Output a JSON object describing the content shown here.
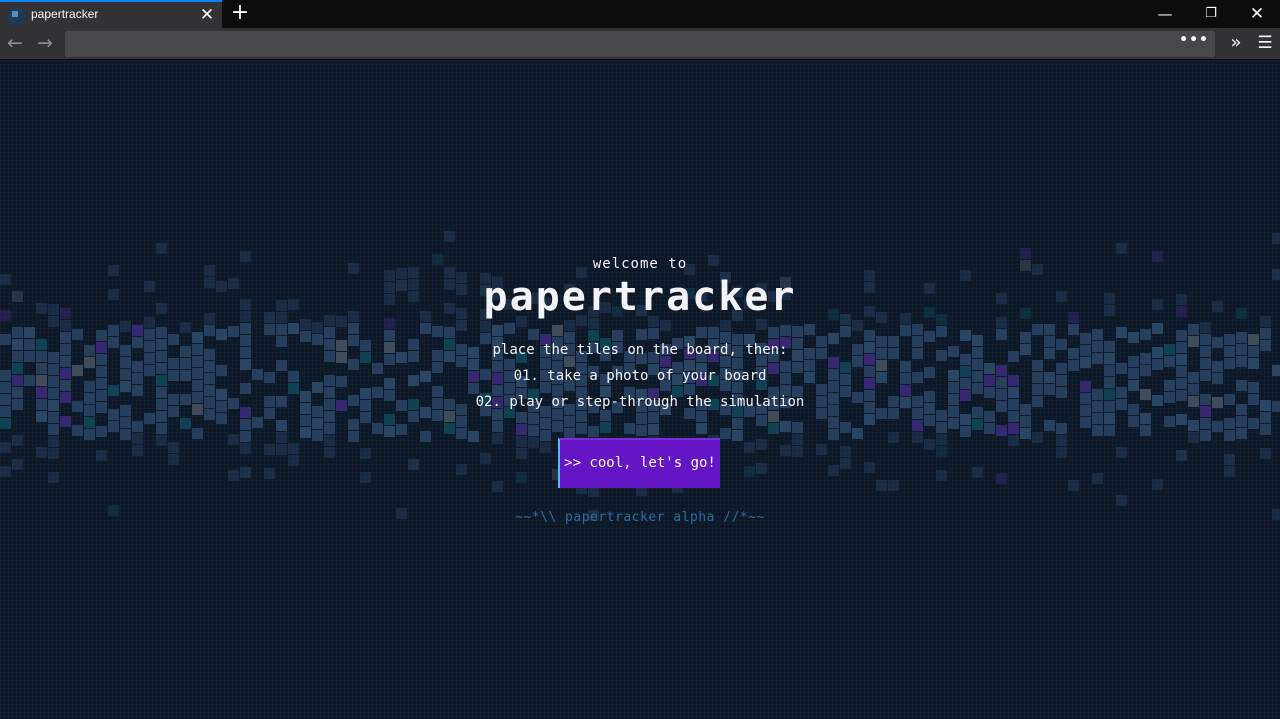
{
  "browser": {
    "tab": {
      "title": "papertracker"
    },
    "colors": {
      "tabbar": "#0c0c0d",
      "toolbar": "#323234",
      "accent": "#0a84ff"
    },
    "icons": [
      "favicon-icon",
      "close-icon",
      "new-tab-icon",
      "minimize-icon",
      "restore-icon",
      "window-close-icon",
      "back-arrow-icon",
      "forward-arrow-icon",
      "page-actions-icon",
      "overflow-icon",
      "menu-icon"
    ]
  },
  "page": {
    "welcome": "welcome to",
    "title": "papertracker",
    "steps": [
      "place the tiles on the board, then:",
      "01. take a photo of your board",
      "02. play or step-through the simulation"
    ],
    "cta_label": ">> cool, let's go!",
    "footer": "~~*\\\\ papertracker alpha //*~~",
    "colors": {
      "background": "#0c1728",
      "button": "#6515c5",
      "button_edge": "#3fc7e8",
      "footer": "#2a6f9f",
      "background_art": [
        "#2b4566",
        "#2f4e6e",
        "#3d2a7e",
        "#0f4a5a",
        "#4a5563"
      ]
    }
  }
}
